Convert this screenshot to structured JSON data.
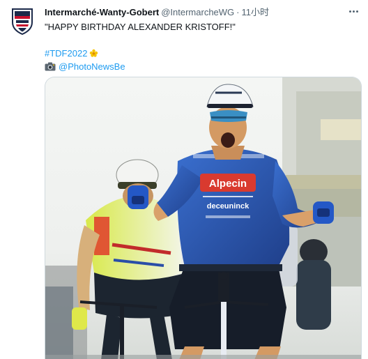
{
  "tweet": {
    "author_name": "Intermarché-Wanty-Gobert",
    "author_handle": "@IntermarcheWG",
    "separator": "·",
    "timestamp": "11小时",
    "text_line1": "\"HAPPY BIRTHDAY ALEXANDER KRISTOFF!\"",
    "hashtag": "#TDF2022",
    "photo_credit": "@PhotoNewsBe",
    "icons": {
      "avatar": "team-shield-logo",
      "more": "more-options-icon",
      "flower": "yellow-flower-emoji",
      "camera": "camera-emoji"
    },
    "colors": {
      "link": "#1d9bf0",
      "text": "#0f1419",
      "secondary": "#536471",
      "jersey_blue": "#2f5fb8"
    },
    "media": {
      "jersey_sponsor_main": "Alpecin",
      "jersey_sponsor_secondary": "deceuninck"
    }
  }
}
